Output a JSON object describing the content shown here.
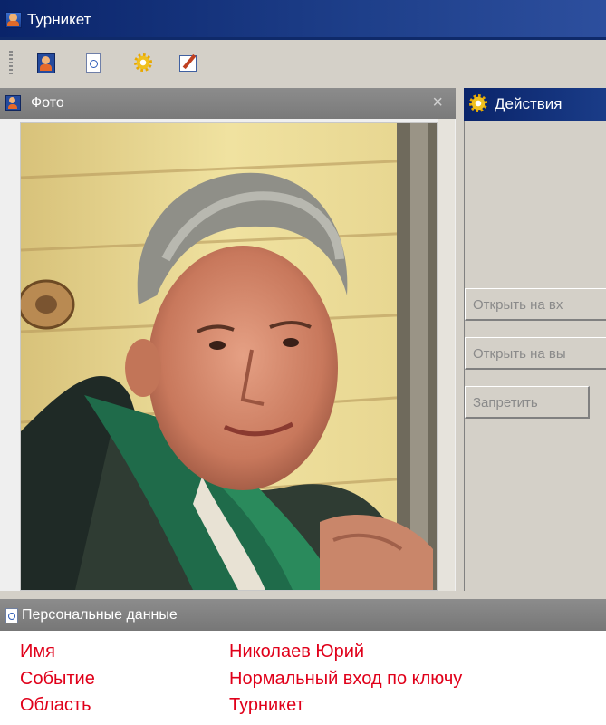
{
  "window": {
    "title": "Турникет"
  },
  "toolbar": {
    "icons": [
      "person-icon",
      "info-doc-icon",
      "gear-icon",
      "edit-icon"
    ]
  },
  "photo_panel": {
    "title": "Фото",
    "close_glyph": "×"
  },
  "actions_panel": {
    "title": "Действия",
    "buttons": [
      "Открыть на вх",
      "Открыть на вы",
      "Запретить"
    ]
  },
  "personal_data": {
    "title": "Персональные данные",
    "rows": [
      {
        "label": "Имя",
        "value": "Николаев Юрий"
      },
      {
        "label": "Событие",
        "value": "Нормальный вход по ключу"
      },
      {
        "label": "Область",
        "value": "Турникет"
      }
    ]
  },
  "colors": {
    "title_bar": "#0a246a",
    "panel_header": "#808080",
    "data_text": "#e0001a",
    "window_bg": "#d4d0c8"
  }
}
